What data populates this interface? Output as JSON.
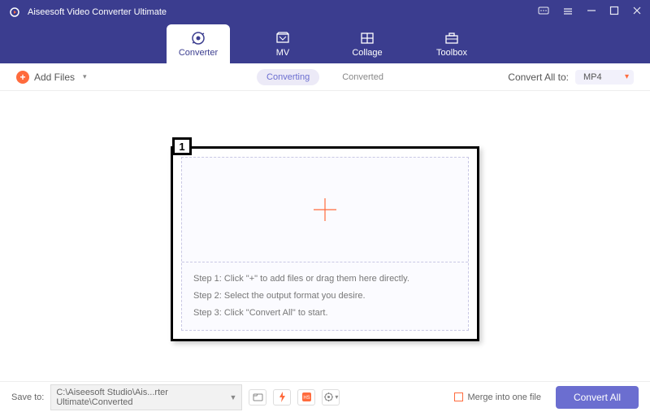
{
  "titlebar": {
    "title": "Aiseesoft Video Converter Ultimate"
  },
  "nav": {
    "tabs": [
      {
        "label": "Converter"
      },
      {
        "label": "MV"
      },
      {
        "label": "Collage"
      },
      {
        "label": "Toolbox"
      }
    ]
  },
  "toolbar": {
    "add_files": "Add Files",
    "segments": {
      "converting": "Converting",
      "converted": "Converted"
    },
    "convert_all_to": "Convert All to:",
    "format": "MP4"
  },
  "callout": {
    "num": "1"
  },
  "steps": {
    "s1": "Step 1: Click \"+\" to add files or drag them here directly.",
    "s2": "Step 2: Select the output format you desire.",
    "s3": "Step 3: Click \"Convert All\" to start."
  },
  "footer": {
    "save_to": "Save to:",
    "path": "C:\\Aiseesoft Studio\\Ais...rter Ultimate\\Converted",
    "merge": "Merge into one file",
    "convert_all": "Convert All"
  }
}
